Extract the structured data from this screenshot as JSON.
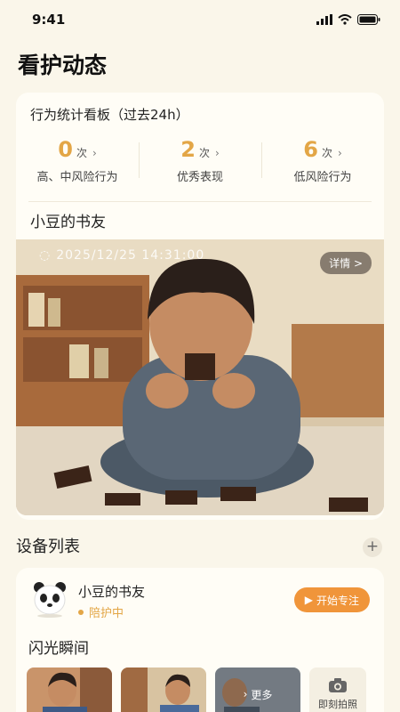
{
  "status_bar": {
    "time": "9:41"
  },
  "page": {
    "title": "看护动态"
  },
  "stats": {
    "title": "行为统计看板（过去24h）",
    "items": [
      {
        "count": "0",
        "unit": "次",
        "label": "高、中风险行为"
      },
      {
        "count": "2",
        "unit": "次",
        "label": "优秀表现"
      },
      {
        "count": "6",
        "unit": "次",
        "label": "低风险行为"
      }
    ]
  },
  "feed": {
    "device_name": "小豆的书友",
    "timestamp": "2025/12/25   14:31:00",
    "detail_label": "详情 >"
  },
  "devices": {
    "section_title": "设备列表",
    "item": {
      "name": "小豆的书友",
      "status": "陪护中",
      "button_label": "开始专注"
    },
    "moments_title": "闪光瞬间",
    "more_label": "更多",
    "snap_label": "即刻拍照"
  },
  "colors": {
    "accent": "#e3a646",
    "button": "#f0953a",
    "background": "#faf6ea"
  }
}
